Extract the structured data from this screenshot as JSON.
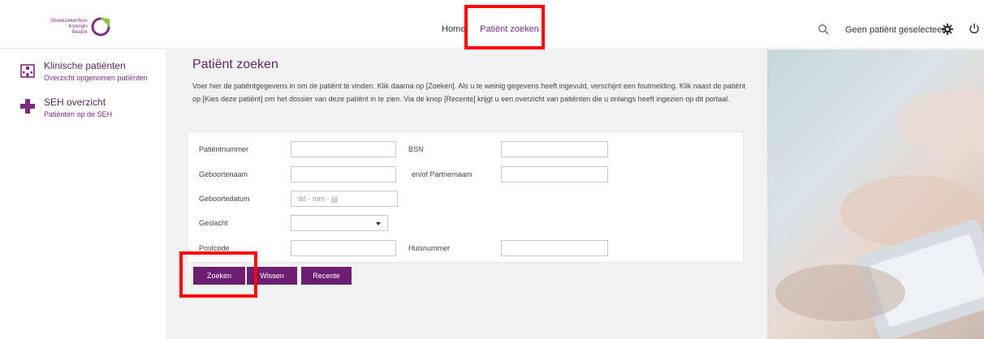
{
  "header": {
    "logo_lines": [
      "Streekziekenhuis",
      "Koningin",
      "Beatrix"
    ],
    "nav": {
      "home": "Home",
      "active": "Patiënt zoeken"
    },
    "patient_status": "Geen patiënt geselecteerd",
    "icons": [
      "search-icon",
      "gear-icon",
      "power-icon"
    ]
  },
  "sidebar": {
    "items": [
      {
        "title": "Klinische patiënten",
        "subtitle": "Overzicht opgenomen patiënten",
        "icon": "hospital-icon"
      },
      {
        "title": "SEH overzicht",
        "subtitle": "Patiënten op de SEH",
        "icon": "cross-icon"
      }
    ]
  },
  "main": {
    "title": "Patiënt zoeken",
    "intro": "Voer hier de patiëntgegevens in om de patiënt te vinden. Klik daarna op [Zoeken]. Als u te weinig gegevens heeft ingevuld, verschijnt een foutmelding. Klik naast de patiënt op [Kies deze patiënt] om het dossier van deze patiënt in te zien. Via de knop [Recente] krijgt u een overzicht van patiënten die u onlangs heeft ingezien op dit portaal.",
    "form": {
      "patientnummer_label": "Patiëntnummer",
      "bsn_label": "BSN",
      "geboortenaam_label": "Geboortenaam",
      "partnernaam_label": "en/of  Partnernaam",
      "geboortedatum_label": "Geboortedatum",
      "geboortedatum_placeholder": "dd  - mm -  jjjj",
      "geslacht_label": "Geslacht",
      "postcode_label": "Postcode",
      "huisnummer_label": "Huisnummer"
    },
    "buttons": {
      "search": "Zoeken",
      "clear": "Wissen",
      "recent": "Recente"
    }
  },
  "colors": {
    "accent": "#7b2d82",
    "button": "#6d1f6f",
    "highlight": "#ff0000"
  }
}
